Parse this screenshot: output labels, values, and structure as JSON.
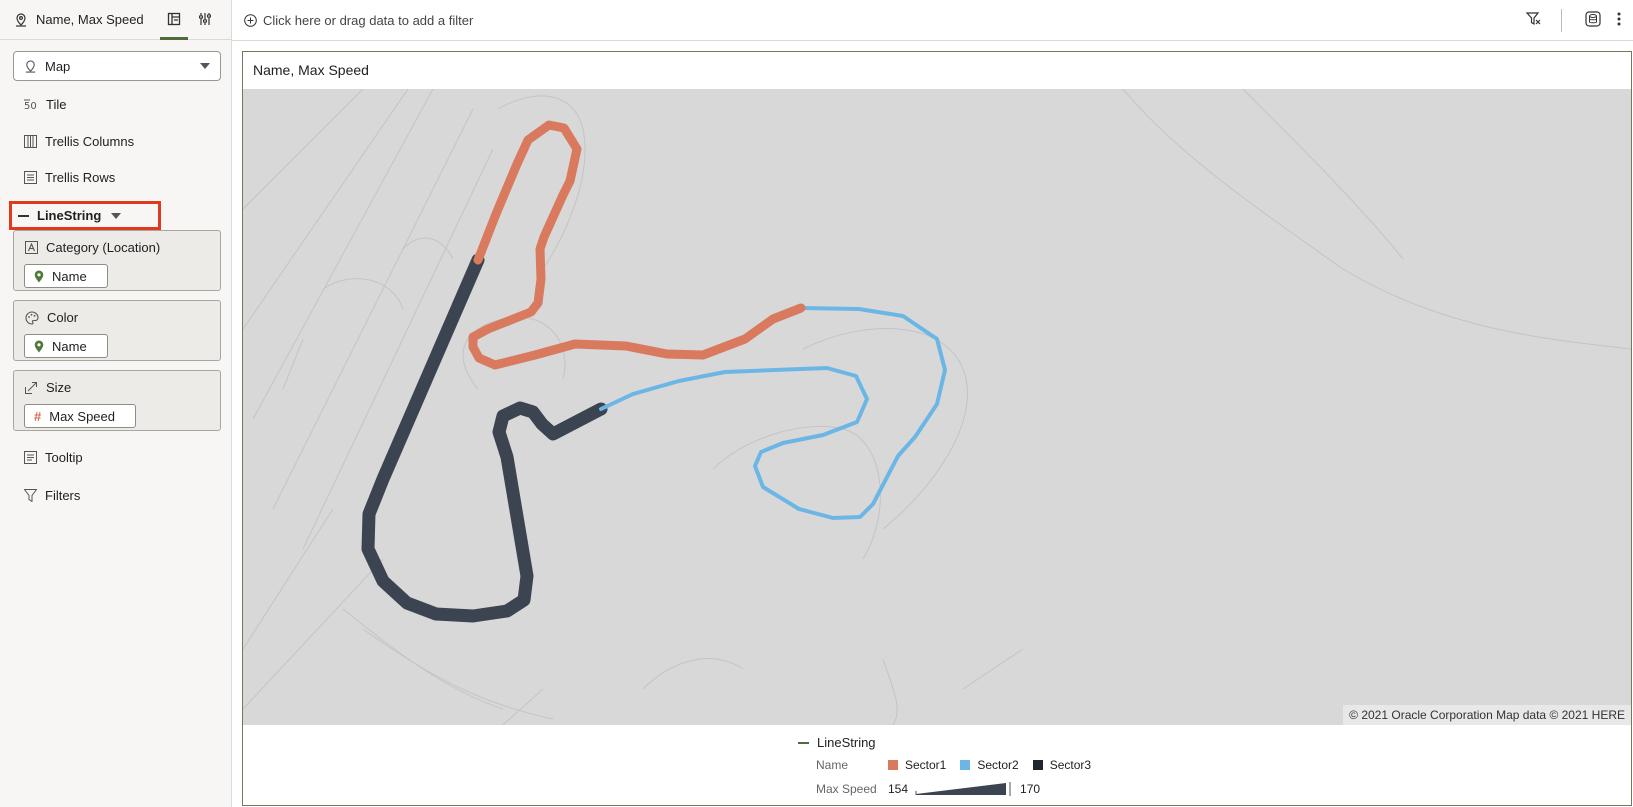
{
  "panel": {
    "title": "Name, Max Speed",
    "viz_type": "Map",
    "rows": {
      "tile": "Tile",
      "trellis_columns": "Trellis Columns",
      "trellis_rows": "Trellis Rows"
    },
    "layer": "LineString",
    "cards": {
      "category": {
        "title": "Category (Location)",
        "pill": "Name"
      },
      "color": {
        "title": "Color",
        "pill": "Name"
      },
      "size": {
        "title": "Size",
        "pill": "Max Speed"
      }
    },
    "tooltip": "Tooltip",
    "filters": "Filters"
  },
  "filterbar": {
    "hint": "Click here or drag data to add a filter"
  },
  "canvas": {
    "title": "Name, Max Speed",
    "attribution": "© 2021 Oracle Corporation   Map data © 2021 HERE"
  },
  "legend": {
    "layer": "LineString",
    "name_label": "Name",
    "items": [
      {
        "label": "Sector1",
        "color": "#d97a5f"
      },
      {
        "label": "Sector2",
        "color": "#6cb6e6"
      },
      {
        "label": "Sector3",
        "color": "#1f2631"
      }
    ],
    "size_label": "Max Speed",
    "size_min": "154",
    "size_max": "170"
  },
  "colors": {
    "accent": "#4f6b3a",
    "highlight": "#e0391d",
    "sector1": "#d97a5f",
    "sector2": "#6cb6e6",
    "sector3": "#3b4450"
  },
  "icons": [
    "location-pin-icon",
    "grammar-icon",
    "properties-icon",
    "chevron-down-icon",
    "tile-icon",
    "trellis-columns-icon",
    "trellis-rows-icon",
    "category-icon",
    "palette-icon",
    "size-icon",
    "hash-icon",
    "tooltip-icon",
    "filter-icon",
    "add-filter-icon",
    "filter-clear-icon",
    "dataset-icon",
    "more-icon"
  ]
}
